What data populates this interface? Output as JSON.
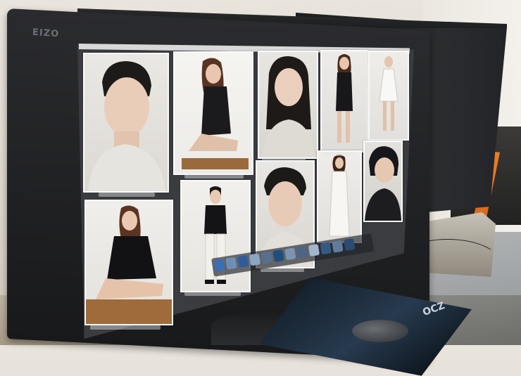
{
  "scene": {
    "monitor_brand": "EIZO",
    "mousepad_brand": "OCZ"
  },
  "photo_grid": {
    "thumbnails": [
      {
        "subject": "man-portrait-turtleneck",
        "row": 1
      },
      {
        "subject": "woman-seated-lace-top",
        "row": 1
      },
      {
        "subject": "woman-portrait-sweater",
        "row": 1
      },
      {
        "subject": "woman-standing-dark-outfit",
        "row": 1
      },
      {
        "subject": "woman-standing-white-dress",
        "row": 1
      },
      {
        "subject": "woman-seated-black-top",
        "row": 2
      },
      {
        "subject": "man-standing-black-white",
        "row": 2
      },
      {
        "subject": "man-portrait-turtleneck-2",
        "row": 2
      },
      {
        "subject": "woman-standing-white-suit",
        "row": 2
      },
      {
        "subject": "man-portrait-dark-hair",
        "row": 2
      }
    ]
  },
  "colors": {
    "bezel": "#1f2022",
    "thumbnail_frame": "#f3f2ef",
    "clamp": "#e5762a"
  },
  "icons": [
    "dock-icons"
  ]
}
